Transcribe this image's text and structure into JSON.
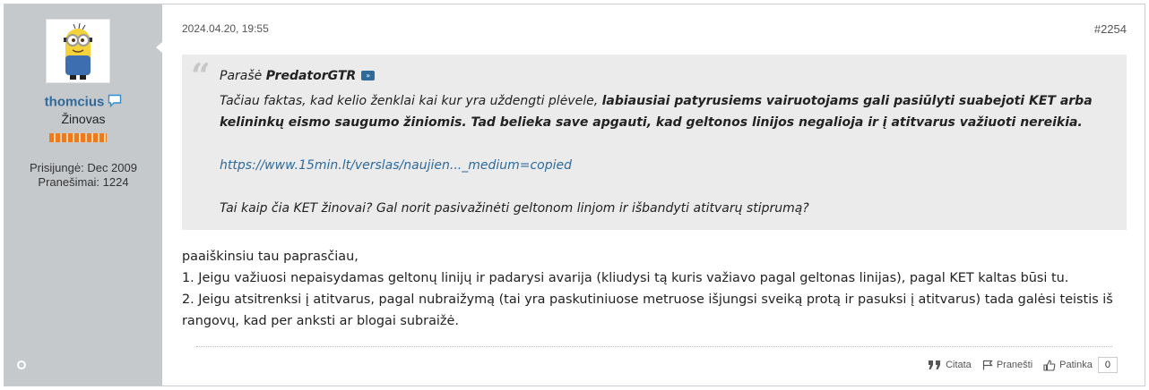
{
  "author": {
    "username": "thomcius",
    "rank": "Žinovas",
    "joined": "Prisijungė: Dec 2009",
    "posts": "Pranešimai: 1224",
    "avatar_icon": "minion-avatar"
  },
  "post": {
    "date": "2024.04.20, 19:55",
    "number": "#2254"
  },
  "quote": {
    "prefix": "Parašė",
    "quoted_author": "PredatorGTR",
    "text_plain": "Tačiau faktas, kad kelio ženklai kai kur yra uždengti plėvele, ",
    "text_bold": "labiausiai patyrusiems vairuotojams gali pasiūlyti suabejoti KET arba kelininkų eismo saugumo žiniomis. Tad belieka save apgauti, kad geltonos linijos negalioja ir į atitvarus važiuoti nereikia.",
    "link": "https://www.15min.lt/verslas/naujien..._medium=copied",
    "question": "Tai kaip čia KET žinovai? Gal norit pasivažinėti geltonom linjom ir išbandyti atitvarų stiprumą?"
  },
  "body": {
    "line1": "paaiškinsiu tau paprasčiau,",
    "line2": "1. Jeigu važiuosi nepaisydamas geltonų linijų ir padarysi avarija (kliudysi tą kuris važiavo pagal geltonas linijas), pagal KET kaltas būsi tu.",
    "line3": "2. Jeigu atsitrenksi į atitvarus, pagal nubraižymą (tai yra paskutiniuose metruose išjungsi sveiką protą ir pasuksi į atitvarus) tada galėsi teistis iš rangovų, kad per anksti ar blogai subraižė."
  },
  "actions": {
    "quote_label": "Citata",
    "report_label": "Pranešti",
    "like_label": "Patinka",
    "like_count": "0"
  },
  "colors": {
    "link": "#2f6a9a",
    "sidebar": "#c6c9cc",
    "quote_bg": "#ebebeb"
  }
}
